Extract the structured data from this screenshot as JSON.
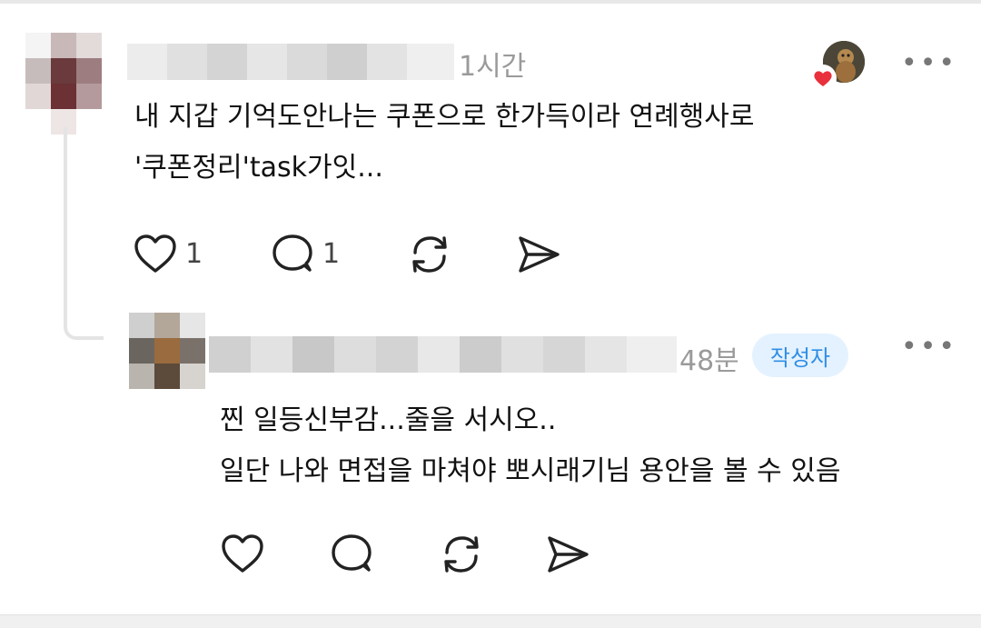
{
  "comment1": {
    "time": "1시간",
    "text_line1": "내 지갑 기억도안나는 쿠폰으로 한가득이라 연례행사로",
    "text_line2": "'쿠폰정리'task가잇...",
    "like_count": "1",
    "reply_count": "1"
  },
  "comment2": {
    "time": "48분",
    "author_badge": "작성자",
    "text_line1": "찐 일등신부감...줄을 서시오..",
    "text_line2": "일단 나와 면접을 마쳐야 뽀시래기님 용안을 볼 수 있음"
  },
  "more_label": "•••",
  "icons": {
    "like": "heart-icon",
    "reply": "comment-bubble-icon",
    "repost": "repost-icon",
    "share": "send-icon",
    "liked": "heart-filled-icon"
  },
  "colors": {
    "badge_bg": "#e4f2ff",
    "badge_text": "#2f8ee6",
    "heart_red": "#e8313c",
    "meta_gray": "#9a9a9a"
  }
}
